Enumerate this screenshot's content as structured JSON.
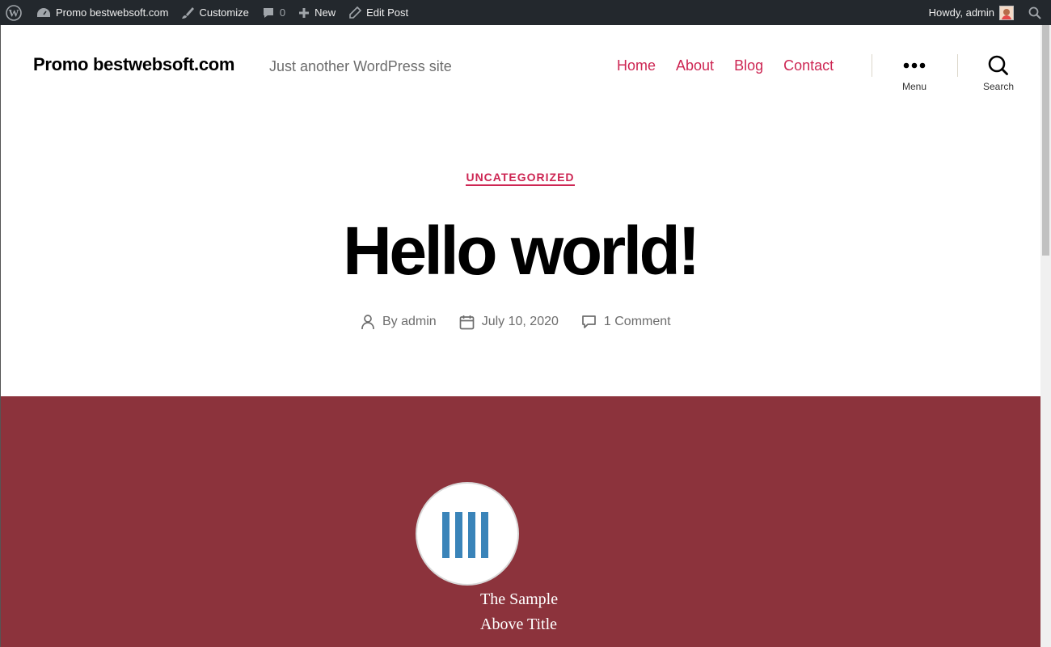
{
  "adminbar": {
    "site_name": "Promo bestwebsoft.com",
    "customize": "Customize",
    "comments_count": "0",
    "new": "New",
    "edit_post": "Edit Post",
    "howdy": "Howdy, admin"
  },
  "header": {
    "site_title": "Promo bestwebsoft.com",
    "site_description": "Just another WordPress site",
    "nav": [
      "Home",
      "About",
      "Blog",
      "Contact"
    ],
    "menu_label": "Menu",
    "search_label": "Search"
  },
  "post": {
    "category": "UNCATEGORIZED",
    "title": "Hello world!",
    "author": "By admin",
    "date": "July 10, 2020",
    "comments": "1 Comment"
  },
  "featured": {
    "line1": "The Sample",
    "line2": "Above Title"
  },
  "colors": {
    "accent": "#cd2653",
    "featured_bg": "#8c333c",
    "adminbar_bg": "#23282d",
    "logo_bars": "#3a84b9"
  }
}
